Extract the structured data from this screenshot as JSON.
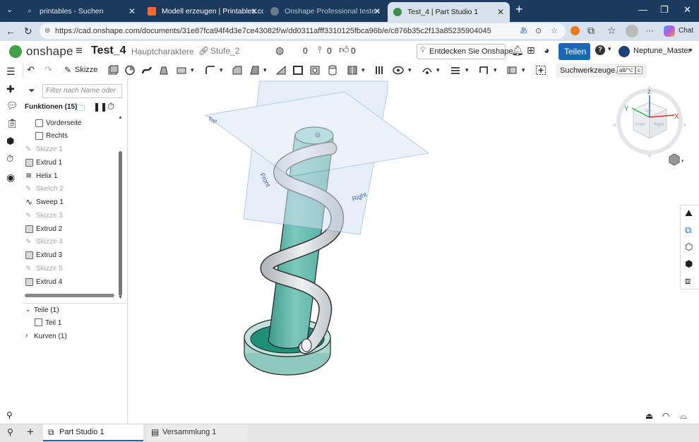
{
  "browser": {
    "tabs": [
      {
        "label": "printables - Suchen",
        "icon": "search-icon",
        "active": false
      },
      {
        "label": "Modell erzeugen | Printables.com",
        "icon": "printables-logo-icon",
        "active": false
      },
      {
        "label": "Onshape Professional testen",
        "icon": "onshape-logo-icon",
        "active": false
      },
      {
        "label": "Test_4 | Part Studio 1",
        "icon": "onshape-logo-icon",
        "active": true
      }
    ],
    "new_tab": "+",
    "url": "https://cad.onshape.com/documents/31e87fca94f4d3e7ce43082f/w/dd0311afff3310125fbca96b/e/c876b35c2f13a85235904045",
    "chat_label": "Chat",
    "more": "···"
  },
  "app": {
    "logo_text": "onshape",
    "doc_title": "Test_4",
    "branch": "Hauptcharaktere",
    "version": "Stufe_2",
    "globe_count": "0",
    "mate_count": "0",
    "like_count": "0",
    "discover": "Entdecken Sie Onshape",
    "share": "Teilen",
    "help": "?",
    "user": "Neptune_Master"
  },
  "toolbar": {
    "sketch": "Skizze",
    "search": "Suchwerkzeuge...",
    "shortcut_1": "alt/⌥",
    "shortcut_2": "c"
  },
  "panel": {
    "filter_placeholder": "Filter nach Name oder",
    "features_title": "Funktionen (15)",
    "features": [
      {
        "label": "Vorderseite",
        "kind": "plane",
        "state": "normal",
        "indent": true
      },
      {
        "label": "Rechts",
        "kind": "plane",
        "state": "normal",
        "indent": true
      },
      {
        "label": "Skizze 1",
        "kind": "sketch",
        "state": "grey",
        "indent": false
      },
      {
        "label": "Extrud 1",
        "kind": "extrude",
        "state": "normal",
        "indent": false
      },
      {
        "label": "Helix 1",
        "kind": "helix",
        "state": "normal",
        "indent": false
      },
      {
        "label": "Sketch 2",
        "kind": "sketch",
        "state": "grey",
        "indent": false
      },
      {
        "label": "Sweep 1",
        "kind": "sweep",
        "state": "normal",
        "indent": false
      },
      {
        "label": "Skizze 3",
        "kind": "sketch",
        "state": "grey",
        "indent": false
      },
      {
        "label": "Extrud 2",
        "kind": "extrude",
        "state": "normal",
        "indent": false
      },
      {
        "label": "Skizze 4",
        "kind": "sketch",
        "state": "grey",
        "indent": false
      },
      {
        "label": "Extrud 3",
        "kind": "extrude",
        "state": "normal",
        "indent": false
      },
      {
        "label": "Skizze 5",
        "kind": "sketch",
        "state": "grey",
        "indent": false
      },
      {
        "label": "Extrud 4",
        "kind": "extrude",
        "state": "normal",
        "indent": false
      }
    ],
    "parts_title": "Teile (1)",
    "part_1": "Teil 1",
    "curves_title": "Kurven (1)"
  },
  "viewport": {
    "plane_top": "Top",
    "plane_front": "Front",
    "plane_right": "Right",
    "axis_x": "X",
    "axis_y": "Y",
    "axis_z": "Z",
    "cube_top": "Top",
    "cube_front": "Front",
    "cube_right": "Right"
  },
  "bottom": {
    "tab_1": "Part Studio 1",
    "tab_2": "Versammlung 1"
  },
  "colors": {
    "browser_frame": "#1c3a5e",
    "address_bg": "#d8e2ee",
    "accent": "#1a68b5",
    "part_teal": "#5fb8aa",
    "helix_grey": "#cfd2d5",
    "plane_blue": "#7c9fd6"
  }
}
